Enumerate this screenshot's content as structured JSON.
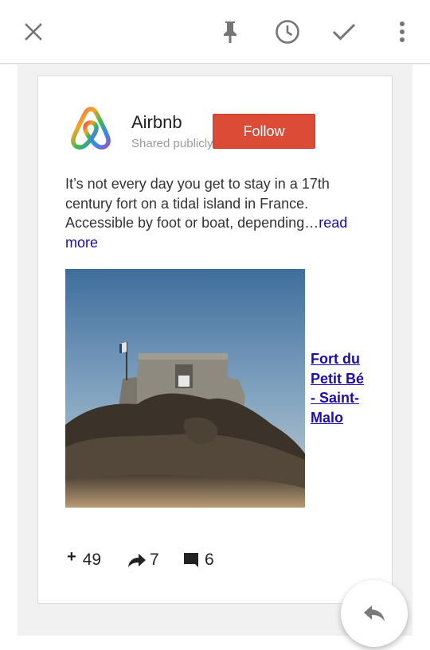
{
  "toolbar": {
    "icons": [
      "close-icon",
      "pin-icon",
      "snooze-clock-icon",
      "check-icon",
      "more-vertical-icon"
    ]
  },
  "post": {
    "author": "Airbnb",
    "visibility": "Shared publicly",
    "follow_label": "Follow",
    "text": "It’s not every day you get to stay in a 17th century fort on a tidal island in France. Accessible by foot or boat, depending…",
    "read_more": "read more",
    "link_title": "Fort du Petit Bé - Saint-Malo",
    "image": "fort-on-rocky-island-photo"
  },
  "stats": {
    "plus_count": "49",
    "share_count": "7",
    "comment_count": "6"
  },
  "fab": {
    "icon": "reply-icon"
  },
  "colors": {
    "follow_button": "#db4b36",
    "link": "#1a0dab",
    "toolbar_icons": "#757575"
  }
}
